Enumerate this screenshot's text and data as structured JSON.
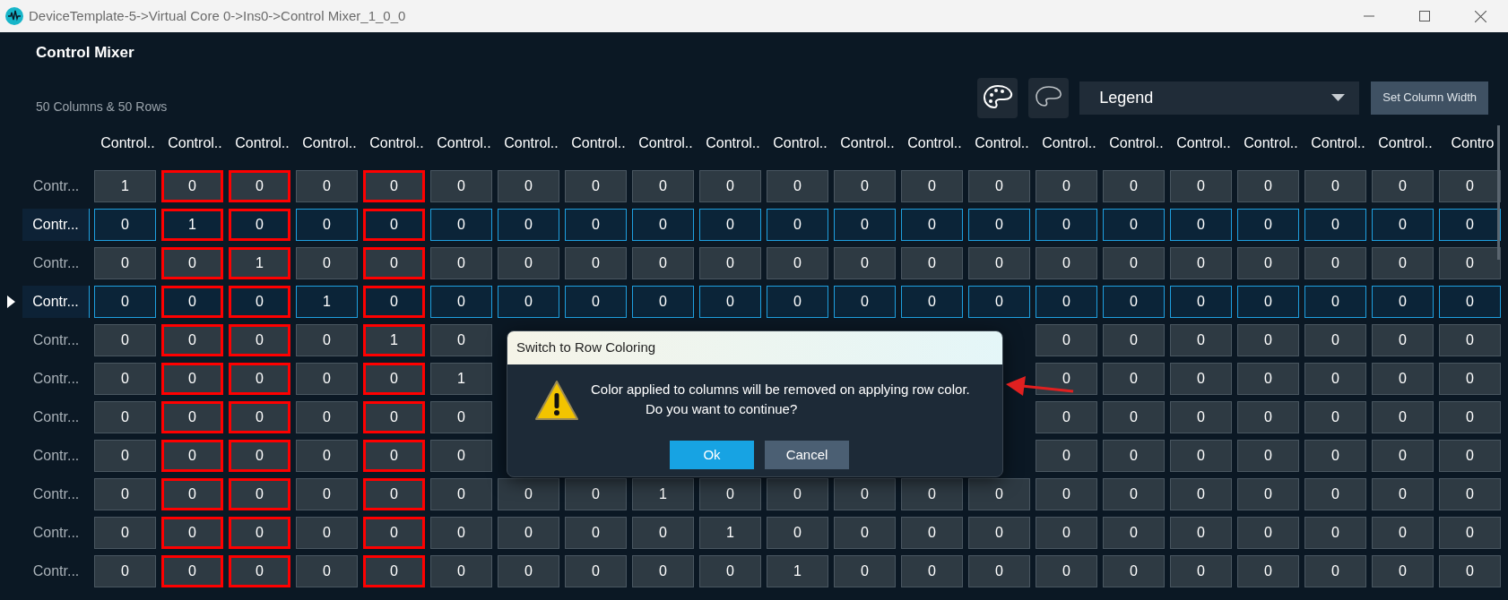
{
  "window": {
    "title": "DeviceTemplate-5->Virtual Core 0->Ins0->Control Mixer_1_0_0"
  },
  "header": {
    "title": "Control Mixer",
    "subtitle": "50 Columns & 50 Rows"
  },
  "toolbar": {
    "dropdown": {
      "value": "Legend"
    },
    "button": "Set Column Width"
  },
  "grid": {
    "columns": [
      {
        "label": "Control..",
        "highlighted": false
      },
      {
        "label": "Control..",
        "highlighted": true
      },
      {
        "label": "Control..",
        "highlighted": true
      },
      {
        "label": "Control..",
        "highlighted": false
      },
      {
        "label": "Control..",
        "highlighted": true
      },
      {
        "label": "Control..",
        "highlighted": false
      },
      {
        "label": "Control..",
        "highlighted": false
      },
      {
        "label": "Control..",
        "highlighted": false
      },
      {
        "label": "Control..",
        "highlighted": false
      },
      {
        "label": "Control..",
        "highlighted": false
      },
      {
        "label": "Control..",
        "highlighted": false
      },
      {
        "label": "Control..",
        "highlighted": false
      },
      {
        "label": "Control..",
        "highlighted": false
      },
      {
        "label": "Control..",
        "highlighted": false
      },
      {
        "label": "Control..",
        "highlighted": false
      },
      {
        "label": "Control..",
        "highlighted": false
      },
      {
        "label": "Control..",
        "highlighted": false
      },
      {
        "label": "Control..",
        "highlighted": false
      },
      {
        "label": "Control..",
        "highlighted": false
      },
      {
        "label": "Control..",
        "highlighted": false
      },
      {
        "label": "Contro",
        "highlighted": false
      }
    ],
    "rows": [
      {
        "label": "Contr...",
        "selected": false,
        "current": false,
        "cells": [
          "1",
          "0",
          "0",
          "0",
          "0",
          "0",
          "0",
          "0",
          "0",
          "0",
          "0",
          "0",
          "0",
          "0",
          "0",
          "0",
          "0",
          "0",
          "0",
          "0",
          "0"
        ]
      },
      {
        "label": "Contr...",
        "selected": true,
        "current": false,
        "cells": [
          "0",
          "1",
          "0",
          "0",
          "0",
          "0",
          "0",
          "0",
          "0",
          "0",
          "0",
          "0",
          "0",
          "0",
          "0",
          "0",
          "0",
          "0",
          "0",
          "0",
          "0"
        ]
      },
      {
        "label": "Contr...",
        "selected": false,
        "current": false,
        "cells": [
          "0",
          "0",
          "1",
          "0",
          "0",
          "0",
          "0",
          "0",
          "0",
          "0",
          "0",
          "0",
          "0",
          "0",
          "0",
          "0",
          "0",
          "0",
          "0",
          "0",
          "0"
        ]
      },
      {
        "label": "Contr...",
        "selected": true,
        "current": true,
        "cells": [
          "0",
          "0",
          "0",
          "1",
          "0",
          "0",
          "0",
          "0",
          "0",
          "0",
          "0",
          "0",
          "0",
          "0",
          "0",
          "0",
          "0",
          "0",
          "0",
          "0",
          "0"
        ]
      },
      {
        "label": "Contr...",
        "selected": false,
        "current": false,
        "cells": [
          "0",
          "0",
          "0",
          "0",
          "1",
          "0",
          null,
          null,
          null,
          null,
          null,
          null,
          null,
          null,
          "0",
          "0",
          "0",
          "0",
          "0",
          "0",
          "0"
        ]
      },
      {
        "label": "Contr...",
        "selected": false,
        "current": false,
        "cells": [
          "0",
          "0",
          "0",
          "0",
          "0",
          "1",
          null,
          null,
          null,
          null,
          null,
          null,
          null,
          null,
          "0",
          "0",
          "0",
          "0",
          "0",
          "0",
          "0"
        ]
      },
      {
        "label": "Contr...",
        "selected": false,
        "current": false,
        "cells": [
          "0",
          "0",
          "0",
          "0",
          "0",
          "0",
          null,
          null,
          null,
          null,
          null,
          null,
          null,
          null,
          "0",
          "0",
          "0",
          "0",
          "0",
          "0",
          "0"
        ]
      },
      {
        "label": "Contr...",
        "selected": false,
        "current": false,
        "cells": [
          "0",
          "0",
          "0",
          "0",
          "0",
          "0",
          null,
          null,
          null,
          null,
          null,
          null,
          null,
          null,
          "0",
          "0",
          "0",
          "0",
          "0",
          "0",
          "0"
        ]
      },
      {
        "label": "Contr...",
        "selected": false,
        "current": false,
        "cells": [
          "0",
          "0",
          "0",
          "0",
          "0",
          "0",
          "0",
          "0",
          "1",
          "0",
          "0",
          "0",
          "0",
          "0",
          "0",
          "0",
          "0",
          "0",
          "0",
          "0",
          "0"
        ]
      },
      {
        "label": "Contr...",
        "selected": false,
        "current": false,
        "cells": [
          "0",
          "0",
          "0",
          "0",
          "0",
          "0",
          "0",
          "0",
          "0",
          "1",
          "0",
          "0",
          "0",
          "0",
          "0",
          "0",
          "0",
          "0",
          "0",
          "0",
          "0"
        ]
      },
      {
        "label": "Contr...",
        "selected": false,
        "current": false,
        "cells": [
          "0",
          "0",
          "0",
          "0",
          "0",
          "0",
          "0",
          "0",
          "0",
          "0",
          "1",
          "0",
          "0",
          "0",
          "0",
          "0",
          "0",
          "0",
          "0",
          "0",
          "0"
        ]
      }
    ]
  },
  "dialog": {
    "title": "Switch to Row Coloring",
    "message_lines": [
      "Color applied to columns will be removed on applying row color.",
      "Do you want to continue?"
    ],
    "buttons": [
      {
        "label": "Ok",
        "kind": "primary"
      },
      {
        "label": "Cancel",
        "kind": "secondary"
      }
    ]
  }
}
